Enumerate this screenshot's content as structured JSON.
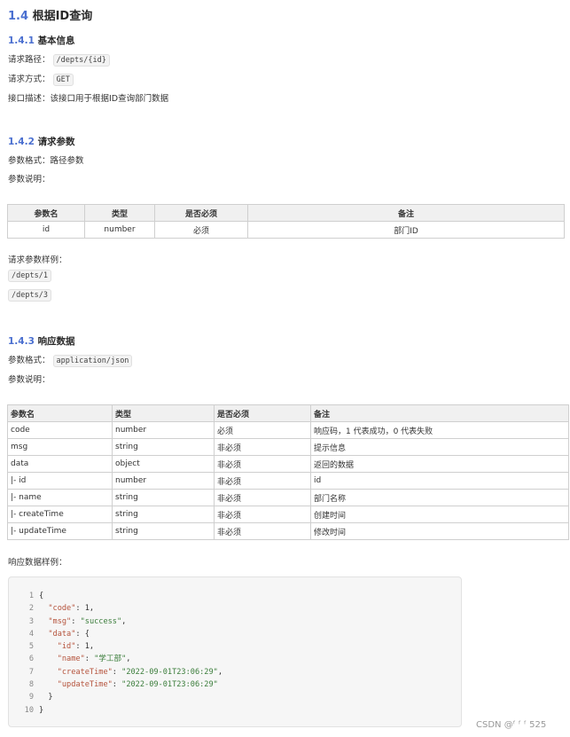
{
  "section": {
    "number": "1.4",
    "title": "根据ID查询"
  },
  "basic": {
    "number": "1.4.1",
    "title": "基本信息",
    "path_label": "请求路径：",
    "path_value": "/depts/{id}",
    "method_label": "请求方式：",
    "method_value": "GET",
    "desc": "接口描述：该接口用于根据ID查询部门数据"
  },
  "params": {
    "number": "1.4.2",
    "title": "请求参数",
    "format": "参数格式：路径参数",
    "desc_label": "参数说明：",
    "headers": [
      "参数名",
      "类型",
      "是否必须",
      "备注"
    ],
    "rows": [
      [
        "id",
        "number",
        "必须",
        "部门ID"
      ]
    ],
    "example_label": "请求参数样例：",
    "examples": [
      "/depts/1",
      "/depts/3"
    ]
  },
  "response": {
    "number": "1.4.3",
    "title": "响应数据",
    "format_label": "参数格式：",
    "format_value": "application/json",
    "desc_label": "参数说明：",
    "headers": [
      "参数名",
      "类型",
      "是否必须",
      "备注"
    ],
    "rows": [
      [
        "code",
        "number",
        "必须",
        "响应码，1 代表成功，0 代表失败"
      ],
      [
        "msg",
        "string",
        "非必须",
        "提示信息"
      ],
      [
        "data",
        "object",
        "非必须",
        "返回的数据"
      ],
      [
        "|- id",
        "number",
        "非必须",
        "id"
      ],
      [
        "|- name",
        "string",
        "非必须",
        "部门名称"
      ],
      [
        "|- createTime",
        "string",
        "非必须",
        "创建时间"
      ],
      [
        "|- updateTime",
        "string",
        "非必须",
        "修改时间"
      ]
    ],
    "example_label": "响应数据样例：",
    "code_lines": [
      {
        "n": "1",
        "t": "{"
      },
      {
        "n": "2",
        "t": "  \"code\": 1,"
      },
      {
        "n": "3",
        "t": "  \"msg\": \"success\","
      },
      {
        "n": "4",
        "t": "  \"data\": {"
      },
      {
        "n": "5",
        "t": "    \"id\": 1,"
      },
      {
        "n": "6",
        "t": "    \"name\": \"学工部\","
      },
      {
        "n": "7",
        "t": "    \"createTime\": \"2022-09-01T23:06:29\","
      },
      {
        "n": "8",
        "t": "    \"updateTime\": \"2022-09-01T23:06:29\""
      },
      {
        "n": "9",
        "t": "  }"
      },
      {
        "n": "10",
        "t": "}"
      }
    ]
  },
  "footer": "CSDN @ᶠ ᶠ ᶠ 525"
}
